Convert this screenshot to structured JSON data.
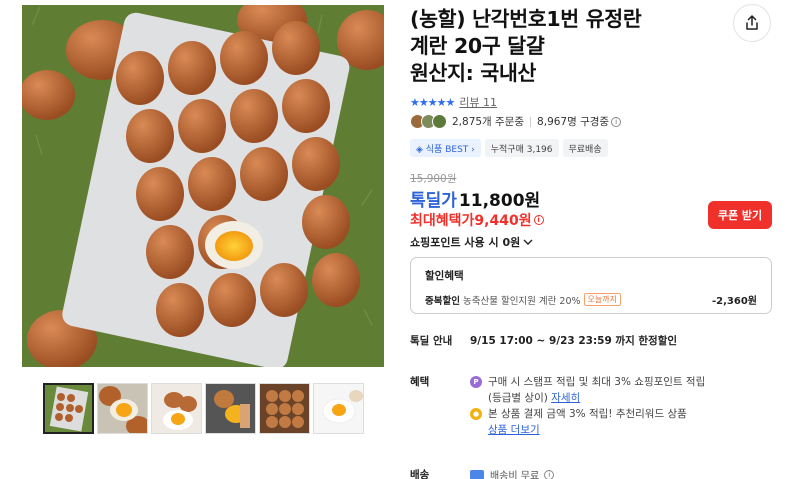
{
  "product": {
    "title_lines": [
      "(농할) 난각번호1번 유정란",
      "계란 20구 달걀",
      "원산지: 국내산"
    ]
  },
  "rating": {
    "stars": "★★★★★",
    "review": "리뷰 11"
  },
  "social": {
    "orders": "2,875개 주문중",
    "subscribers": "8,967명 구경중"
  },
  "badges": [
    "◈ 식품 BEST ›",
    "누적구매 3,196",
    "무료배송"
  ],
  "price": {
    "original": "15,900원",
    "deal_label": "톡딜가",
    "deal_price": "11,800원",
    "max_label": "최대혜택가",
    "max_price": "9,440원",
    "coupon": "쿠폰 받기",
    "points": "쇼핑포인트 사용 시",
    "points_value": "0원"
  },
  "discount": {
    "head": "할인혜택",
    "key": "중복할인",
    "desc": "농축산물 할인지원 계란 20%",
    "tag": "오늘까지",
    "amount": "-2,360원"
  },
  "deal_info": {
    "label": "톡딜 안내",
    "text": "9/15 17:00 ~ 9/23 23:59 까지 한정할인"
  },
  "benefit": {
    "label": "혜택",
    "line1": "구매 시 스탬프 적립 및 최대 3% 쇼핑포인트 적립",
    "line1b": "(등급별 상이)",
    "line1_link": "자세히",
    "line2": "본 상품 결제 금액 3% 적립! 추천리워드 상품",
    "line2_link": "상품 더보기"
  },
  "shipping": {
    "label": "배송",
    "value": "배송비 무료"
  },
  "colors": {
    "accent_blue": "#2e63d8",
    "accent_red": "#f0312b"
  }
}
